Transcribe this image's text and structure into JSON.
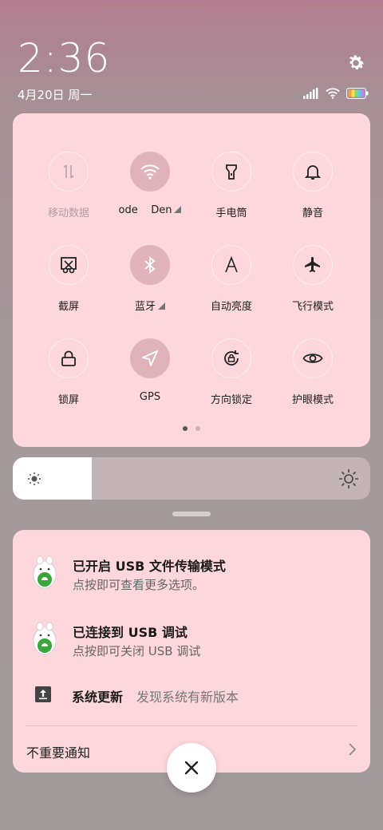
{
  "status": {
    "time": "2:36",
    "date": "4月20日 周一"
  },
  "quick_settings": {
    "tiles": [
      {
        "label": "移动数据",
        "icon": "mobile-data-icon",
        "active": false
      },
      {
        "label": "ode    Den",
        "icon": "wifi-icon",
        "active": true
      },
      {
        "label": "手电筒",
        "icon": "flashlight-icon",
        "active": false
      },
      {
        "label": "静音",
        "icon": "bell-icon",
        "active": false
      },
      {
        "label": "截屏",
        "icon": "screenshot-icon",
        "active": false
      },
      {
        "label": "蓝牙",
        "icon": "bluetooth-icon",
        "active": true
      },
      {
        "label": "自动亮度",
        "icon": "auto-brightness-icon",
        "active": false
      },
      {
        "label": "飞行模式",
        "icon": "airplane-icon",
        "active": false
      },
      {
        "label": "锁屏",
        "icon": "lock-icon",
        "active": false
      },
      {
        "label": "GPS",
        "icon": "location-icon",
        "active": true
      },
      {
        "label": "方向锁定",
        "icon": "rotation-lock-icon",
        "active": false
      },
      {
        "label": "护眼模式",
        "icon": "eye-icon",
        "active": false
      }
    ],
    "page_count": 2,
    "current_page": 1
  },
  "brightness": {
    "level": 0.22
  },
  "notifications": {
    "items": [
      {
        "title": "已开启 USB 文件传输模式",
        "body": "点按即可查看更多选项。"
      },
      {
        "title": "已连接到 USB 调试",
        "body": "点按即可关闭 USB 调试"
      }
    ],
    "update": {
      "title": "系统更新",
      "body": "发现系统有新版本"
    },
    "unimportant_label": "不重要通知"
  },
  "colors": {
    "panel": "#fdd7db",
    "active_circle": "#e0b3bb",
    "android_green": "#3aa63a"
  }
}
